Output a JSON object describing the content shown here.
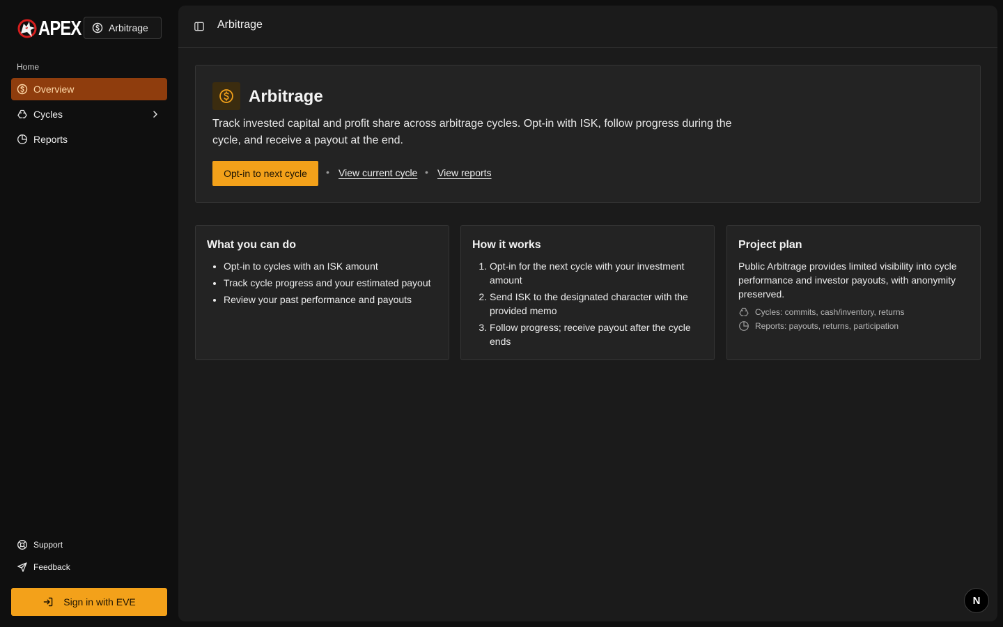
{
  "brand": {
    "logo_text": "APEX"
  },
  "app_switcher": {
    "label": "Arbitrage",
    "icon": "dollar-circle-icon"
  },
  "sidebar": {
    "section_label": "Home",
    "items": [
      {
        "label": "Overview",
        "icon": "dollar-circle-icon",
        "active": true
      },
      {
        "label": "Cycles",
        "icon": "recycle-icon",
        "has_submenu": true
      },
      {
        "label": "Reports",
        "icon": "pie-chart-icon"
      }
    ],
    "footer": [
      {
        "label": "Support",
        "icon": "life-buoy-icon"
      },
      {
        "label": "Feedback",
        "icon": "send-icon"
      }
    ],
    "signin_label": "Sign in with EVE"
  },
  "header": {
    "title": "Arbitrage"
  },
  "hero": {
    "title": "Arbitrage",
    "description": "Track invested capital and profit share across arbitrage cycles. Opt-in with ISK, follow progress during the cycle, and receive a payout at the end.",
    "cta_label": "Opt-in to next cycle",
    "separator": "•",
    "links": [
      "View current cycle",
      "View reports"
    ]
  },
  "cards": {
    "can_do": {
      "title": "What you can do",
      "items": [
        "Opt-in to cycles with an ISK amount",
        "Track cycle progress and your estimated payout",
        "Review your past performance and payouts"
      ]
    },
    "how": {
      "title": "How it works",
      "steps": [
        "Opt-in for the next cycle with your investment amount",
        "Send ISK to the designated character with the provided memo",
        "Follow progress; receive payout after the cycle ends"
      ]
    },
    "plan": {
      "title": "Project plan",
      "text": "Public Arbitrage provides limited visibility into cycle performance and investor payouts, with anonymity preserved.",
      "meta": [
        "Cycles: commits, cash/inventory, returns",
        "Reports: payouts, returns, participation"
      ]
    }
  },
  "floating_badge": "N",
  "colors": {
    "accent": "#f3a11a",
    "active_nav": "#8f3d0d",
    "panel": "#1b1b1b",
    "card": "#232323"
  }
}
